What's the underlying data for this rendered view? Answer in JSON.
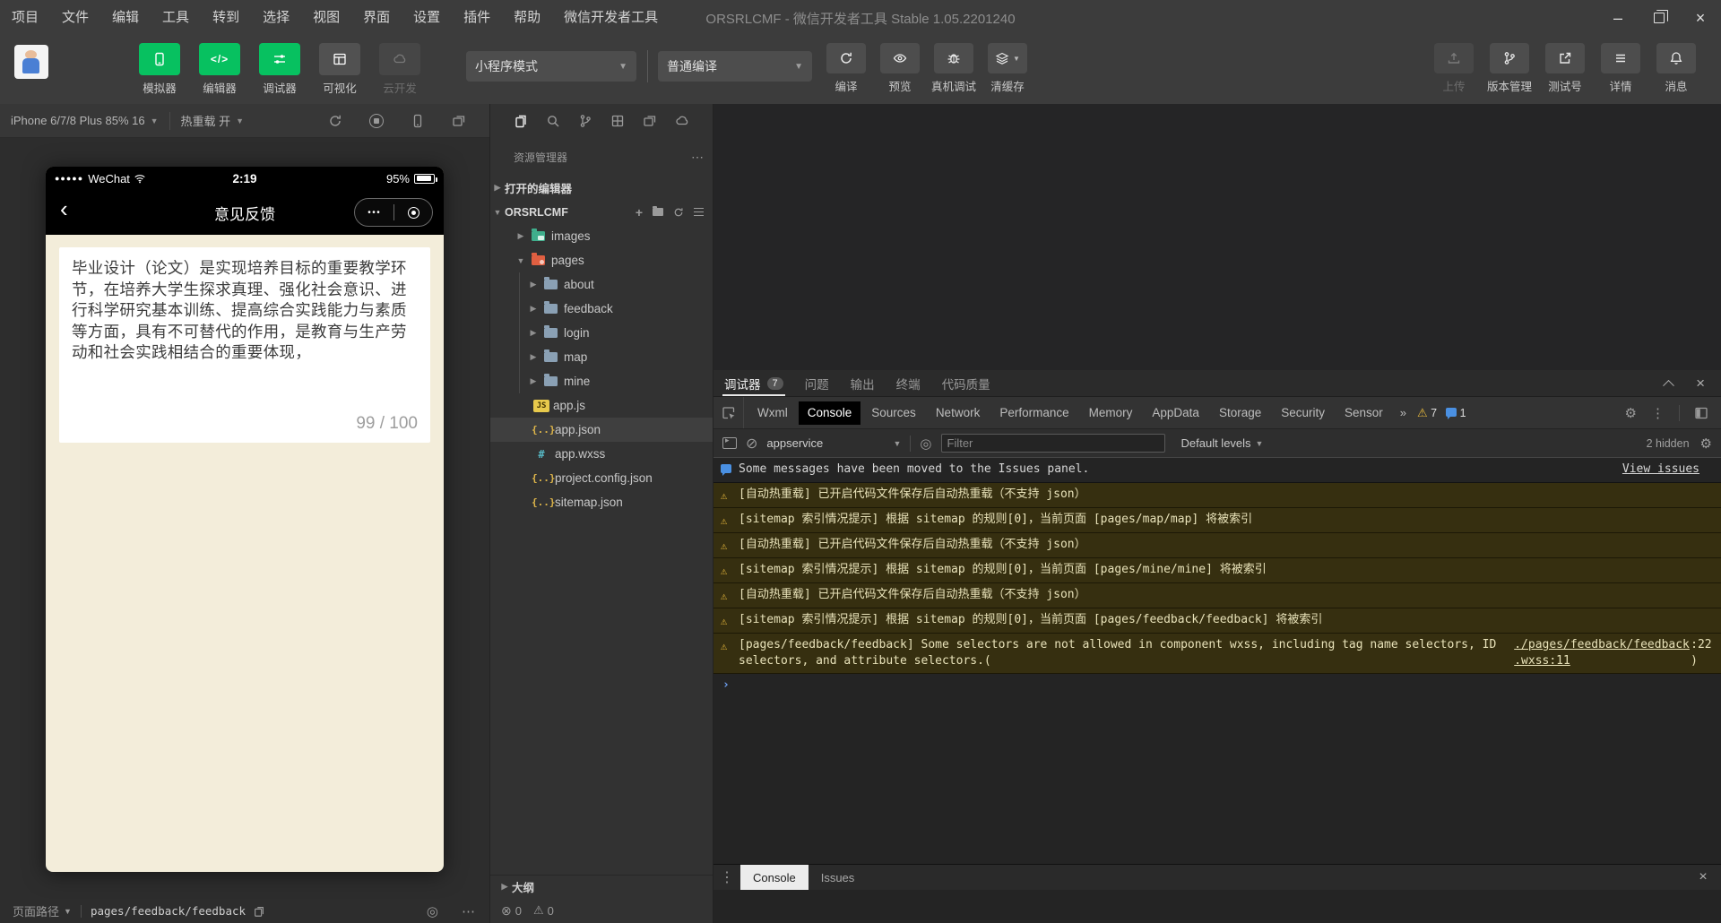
{
  "window": {
    "title": "ORSRLCMF - 微信开发者工具 Stable 1.05.2201240"
  },
  "menu": {
    "items": [
      "项目",
      "文件",
      "编辑",
      "工具",
      "转到",
      "选择",
      "视图",
      "界面",
      "设置",
      "插件",
      "帮助",
      "微信开发者工具"
    ]
  },
  "toolbar": {
    "tools": [
      {
        "label": "模拟器",
        "icon": "phone-icon",
        "style": "green"
      },
      {
        "label": "编辑器",
        "icon": "code-icon",
        "style": "green"
      },
      {
        "label": "调试器",
        "icon": "sliders-icon",
        "style": "green"
      },
      {
        "label": "可视化",
        "icon": "layout-icon",
        "style": "gray"
      },
      {
        "label": "云开发",
        "icon": "cloud-icon",
        "style": "disabled"
      }
    ],
    "mode_select": "小程序模式",
    "compile_select": "普通编译",
    "actions": [
      {
        "label": "编译",
        "icon": "refresh-icon"
      },
      {
        "label": "预览",
        "icon": "eye-icon"
      },
      {
        "label": "真机调试",
        "icon": "bug-icon"
      },
      {
        "label": "清缓存",
        "icon": "layers-icon"
      }
    ],
    "right_actions": [
      {
        "label": "上传",
        "icon": "upload-icon",
        "disabled": true
      },
      {
        "label": "版本管理",
        "icon": "branch-icon"
      },
      {
        "label": "测试号",
        "icon": "external-link-icon"
      },
      {
        "label": "详情",
        "icon": "hamburger-icon"
      },
      {
        "label": "消息",
        "icon": "bell-icon"
      }
    ]
  },
  "simulator": {
    "device": "iPhone 6/7/8 Plus 85% 16",
    "hot_reload": "热重载 开",
    "phone": {
      "carrier": "WeChat",
      "time": "2:19",
      "battery": "95%",
      "nav_title": "意见反馈",
      "textarea_value": "毕业设计（论文）是实现培养目标的重要教学环节，在培养大学生探求真理、强化社会意识、进行科学研究基本训练、提高综合实践能力与素质等方面，具有不可替代的作用，是教育与生产劳动和社会实践相结合的重要体现，",
      "counter": "99 / 100"
    },
    "page_path_label": "页面路径",
    "page_path": "pages/feedback/feedback"
  },
  "explorer": {
    "title": "资源管理器",
    "open_editors": "打开的编辑器",
    "project": "ORSRLCMF",
    "tree": [
      {
        "label": "images",
        "icon": "folder-images",
        "arrow": "collapsed",
        "indent": 1
      },
      {
        "label": "pages",
        "icon": "folder-pages",
        "arrow": "expanded",
        "indent": 1
      },
      {
        "label": "about",
        "icon": "folder",
        "arrow": "collapsed",
        "indent": 2
      },
      {
        "label": "feedback",
        "icon": "folder",
        "arrow": "collapsed",
        "indent": 2
      },
      {
        "label": "login",
        "icon": "folder",
        "arrow": "collapsed",
        "indent": 2
      },
      {
        "label": "map",
        "icon": "folder",
        "arrow": "collapsed",
        "indent": 2
      },
      {
        "label": "mine",
        "icon": "folder",
        "arrow": "collapsed",
        "indent": 2
      },
      {
        "label": "app.js",
        "icon": "js",
        "indent": 1
      },
      {
        "label": "app.json",
        "icon": "json",
        "indent": 1,
        "selected": true
      },
      {
        "label": "app.wxss",
        "icon": "wxss",
        "indent": 1
      },
      {
        "label": "project.config.json",
        "icon": "json",
        "indent": 1
      },
      {
        "label": "sitemap.json",
        "icon": "json",
        "indent": 1
      }
    ],
    "outline": "大纲",
    "problems": {
      "errors": "0",
      "warnings": "0"
    }
  },
  "debugger": {
    "tabs": [
      {
        "label": "调试器",
        "badge": "7",
        "active": true
      },
      {
        "label": "问题"
      },
      {
        "label": "输出"
      },
      {
        "label": "终端"
      },
      {
        "label": "代码质量"
      }
    ],
    "devtools_tabs": [
      "Wxml",
      "Console",
      "Sources",
      "Network",
      "Performance",
      "Memory",
      "AppData",
      "Storage",
      "Security",
      "Sensor"
    ],
    "active_devtools_tab": "Console",
    "more_tabs_glyph": "»",
    "warn_count": "7",
    "info_count": "1",
    "console": {
      "context": "appservice",
      "filter_placeholder": "Filter",
      "levels": "Default levels",
      "hidden": "2 hidden",
      "messages": [
        {
          "type": "info",
          "text": "Some messages have been moved to the Issues panel.",
          "action": "View issues"
        },
        {
          "type": "warning",
          "text": "[自动热重载] 已开启代码文件保存后自动热重载（不支持 json）"
        },
        {
          "type": "warning",
          "text": "[sitemap 索引情况提示] 根据 sitemap 的规则[0]，当前页面 [pages/map/map] 将被索引"
        },
        {
          "type": "warning",
          "text": "[自动热重载] 已开启代码文件保存后自动热重载（不支持 json）"
        },
        {
          "type": "warning",
          "text": "[sitemap 索引情况提示] 根据 sitemap 的规则[0]，当前页面 [pages/mine/mine] 将被索引"
        },
        {
          "type": "warning",
          "text": "[自动热重载] 已开启代码文件保存后自动热重载（不支持 json）"
        },
        {
          "type": "warning",
          "text": "[sitemap 索引情况提示] 根据 sitemap 的规则[0]，当前页面 [pages/feedback/feedback] 将被索引"
        },
        {
          "type": "warning",
          "text": "[pages/feedback/feedback] Some selectors are not allowed in component wxss, including tag name selectors, ID selectors, and attribute selectors.(",
          "link": "./pages/feedback/feedback.wxss:11",
          "suffix": ":22)"
        }
      ]
    },
    "drawer": {
      "tabs": [
        "Console",
        "Issues"
      ],
      "active": "Console"
    }
  }
}
